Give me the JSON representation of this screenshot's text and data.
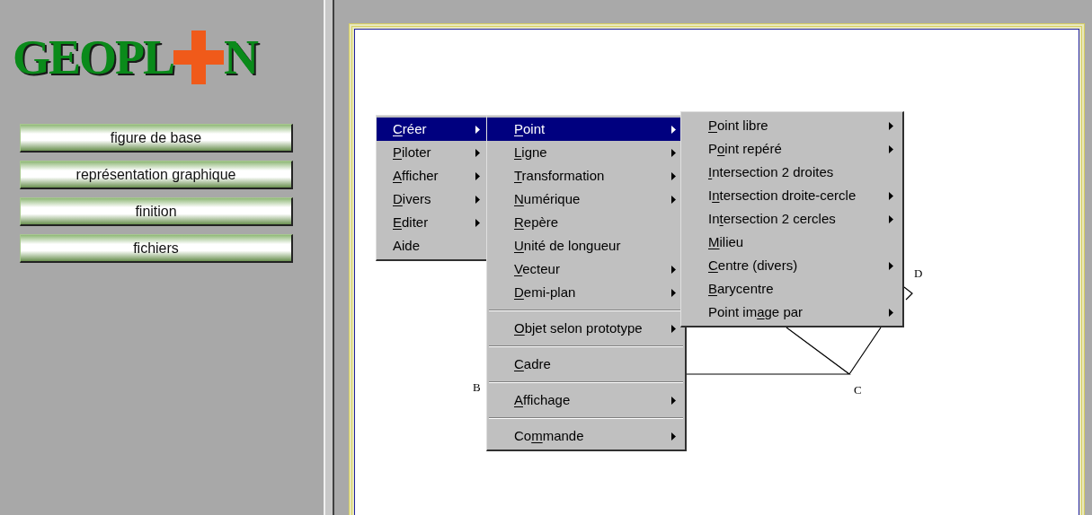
{
  "logo": {
    "left": "GEOPL",
    "right": "N"
  },
  "sidebar": {
    "buttons": [
      {
        "label": "figure de base"
      },
      {
        "label": "représentation graphique"
      },
      {
        "label": "finition"
      },
      {
        "label": "fichiers"
      }
    ]
  },
  "figure": {
    "points": [
      {
        "label": "B"
      },
      {
        "label": "C"
      },
      {
        "label": "D"
      }
    ]
  },
  "menus": [
    {
      "items": [
        {
          "kind": "item",
          "key": "C",
          "post": "réer",
          "submenu": true,
          "selected": true
        },
        {
          "kind": "item",
          "key": "P",
          "post": "iloter",
          "submenu": true,
          "selected": false
        },
        {
          "kind": "item",
          "key": "A",
          "post": "fficher",
          "submenu": true,
          "selected": false
        },
        {
          "kind": "item",
          "key": "D",
          "post": "ivers",
          "submenu": true,
          "selected": false
        },
        {
          "kind": "item",
          "key": "E",
          "post": "diter",
          "submenu": true,
          "selected": false
        },
        {
          "kind": "item",
          "pre": "Aide",
          "submenu": false,
          "selected": false
        }
      ]
    },
    {
      "items": [
        {
          "kind": "item",
          "key": "P",
          "post": "oint",
          "submenu": true,
          "selected": true
        },
        {
          "kind": "item",
          "key": "L",
          "post": "igne",
          "submenu": true,
          "selected": false
        },
        {
          "kind": "item",
          "key": "T",
          "post": "ransformation",
          "submenu": true,
          "selected": false
        },
        {
          "kind": "item",
          "key": "N",
          "post": "umérique",
          "submenu": true,
          "selected": false
        },
        {
          "kind": "item",
          "key": "R",
          "post": "epère",
          "submenu": false,
          "selected": false
        },
        {
          "kind": "item",
          "key": "U",
          "post": "nité de longueur",
          "submenu": false,
          "selected": false
        },
        {
          "kind": "item",
          "key": "V",
          "post": "ecteur",
          "submenu": true,
          "selected": false
        },
        {
          "kind": "item",
          "key": "D",
          "post": "emi-plan",
          "submenu": true,
          "selected": false
        },
        {
          "kind": "separator"
        },
        {
          "kind": "item",
          "key": "O",
          "post": "bjet selon prototype",
          "submenu": true,
          "selected": false
        },
        {
          "kind": "separator"
        },
        {
          "kind": "item",
          "key": "C",
          "post": "adre",
          "submenu": false,
          "selected": false
        },
        {
          "kind": "separator"
        },
        {
          "kind": "item",
          "key": "A",
          "post": "ffichage",
          "submenu": true,
          "selected": false
        },
        {
          "kind": "separator"
        },
        {
          "kind": "item",
          "pre": "Co",
          "key": "m",
          "post": "mande",
          "submenu": true,
          "selected": false
        }
      ]
    },
    {
      "items": [
        {
          "kind": "item",
          "key": "P",
          "post": "oint libre",
          "submenu": true,
          "selected": false
        },
        {
          "kind": "item",
          "pre": "P",
          "key": "o",
          "post": "int repéré",
          "submenu": true,
          "selected": false
        },
        {
          "kind": "item",
          "key": "I",
          "post": "ntersection 2 droites",
          "submenu": false,
          "selected": false
        },
        {
          "kind": "item",
          "pre": "I",
          "key": "n",
          "post": "tersection droite-cercle",
          "submenu": true,
          "selected": false
        },
        {
          "kind": "item",
          "pre": "In",
          "key": "t",
          "post": "ersection 2 cercles",
          "submenu": true,
          "selected": false
        },
        {
          "kind": "item",
          "key": "M",
          "post": "ilieu",
          "submenu": false,
          "selected": false
        },
        {
          "kind": "item",
          "key": "C",
          "post": "entre (divers)",
          "submenu": true,
          "selected": false
        },
        {
          "kind": "item",
          "key": "B",
          "post": "arycentre",
          "submenu": false,
          "selected": false
        },
        {
          "kind": "item",
          "pre": "Point im",
          "key": "a",
          "post": "ge par",
          "submenu": true,
          "selected": false
        }
      ]
    }
  ]
}
